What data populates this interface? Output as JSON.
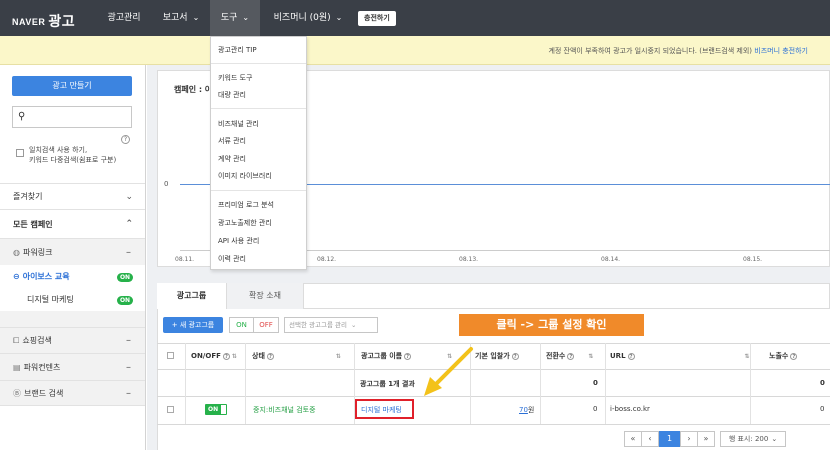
{
  "topbar": {
    "brand_naver": "NAVER",
    "brand_ad": "광고",
    "nav_manage": "광고관리",
    "nav_report": "보고서",
    "nav_tools": "도구",
    "nav_bizmoney": "비즈머니 (0원)",
    "charge_button": "충전하기"
  },
  "notice": {
    "text": "계정 잔액이 부족하여 광고가 일시중지 되었습니다. (브랜드검색 제외) ",
    "link": "비즈머니 충전하기"
  },
  "tools_menu": {
    "items": [
      "광고관리 TIP",
      "키워드 도구",
      "대량 관리",
      "비즈채널 관리",
      "서류 관리",
      "계약 관리",
      "이미지 라이브러리",
      "프리미엄 로그 분석",
      "광고노출제한 관리",
      "API 사용 관리",
      "이력 관리"
    ]
  },
  "sidebar": {
    "make_ad": "광고 만들기",
    "search_placeholder": "",
    "checkbox_label_1": "일치검색 사용 하기,",
    "checkbox_label_2": "키워드 다중검색(쉼표로 구분)",
    "help": "?",
    "favorites": "즐겨찾기",
    "all_campaigns": "모든 캠페인",
    "powerlink": "파워링크",
    "campaign_name": "아이보스 교육",
    "campaign_status": "ON",
    "adgroup_name": "디지털 마케팅",
    "adgroup_status": "ON",
    "shopping": "쇼핑검색",
    "powercontents": "파워컨텐츠",
    "brand": "브랜드 검색"
  },
  "chart": {
    "campaign_label": "캠페인 : 아",
    "zero": "0",
    "ticks": [
      "08.11.",
      "08.12.",
      "08.13.",
      "08.14.",
      "08.15."
    ]
  },
  "tabs": {
    "adgroup": "광고그룹",
    "extension": "확장 소재"
  },
  "toolbar": {
    "new_group": "+ 새 광고그룹",
    "on": "ON",
    "off": "OFF",
    "select_manage": "선택한 광고그룹 관리"
  },
  "callout": "클릭 -> 그룹 설정 확인",
  "table": {
    "headers": {
      "onoff": "ON/OFF",
      "status": "상태",
      "name": "광고그룹 이름",
      "bid": "기본 입찰가",
      "conversions": "전환수",
      "url": "URL",
      "impressions": "노출수"
    },
    "summary": {
      "label": "광고그룹 1개 결과",
      "bid": "",
      "conversions": "0",
      "impressions": "0"
    },
    "row": {
      "toggle": "ON",
      "status": "중지:비즈채널 검토중",
      "name": "디지털 마케팅",
      "bid": "70",
      "bid_unit": "원",
      "conversions": "0",
      "url": "i-boss.co.kr",
      "impressions": "0"
    }
  },
  "pager": {
    "first": "«",
    "prev": "‹",
    "page": "1",
    "next": "›",
    "last": "»",
    "per_page": "행 표시: 200"
  }
}
